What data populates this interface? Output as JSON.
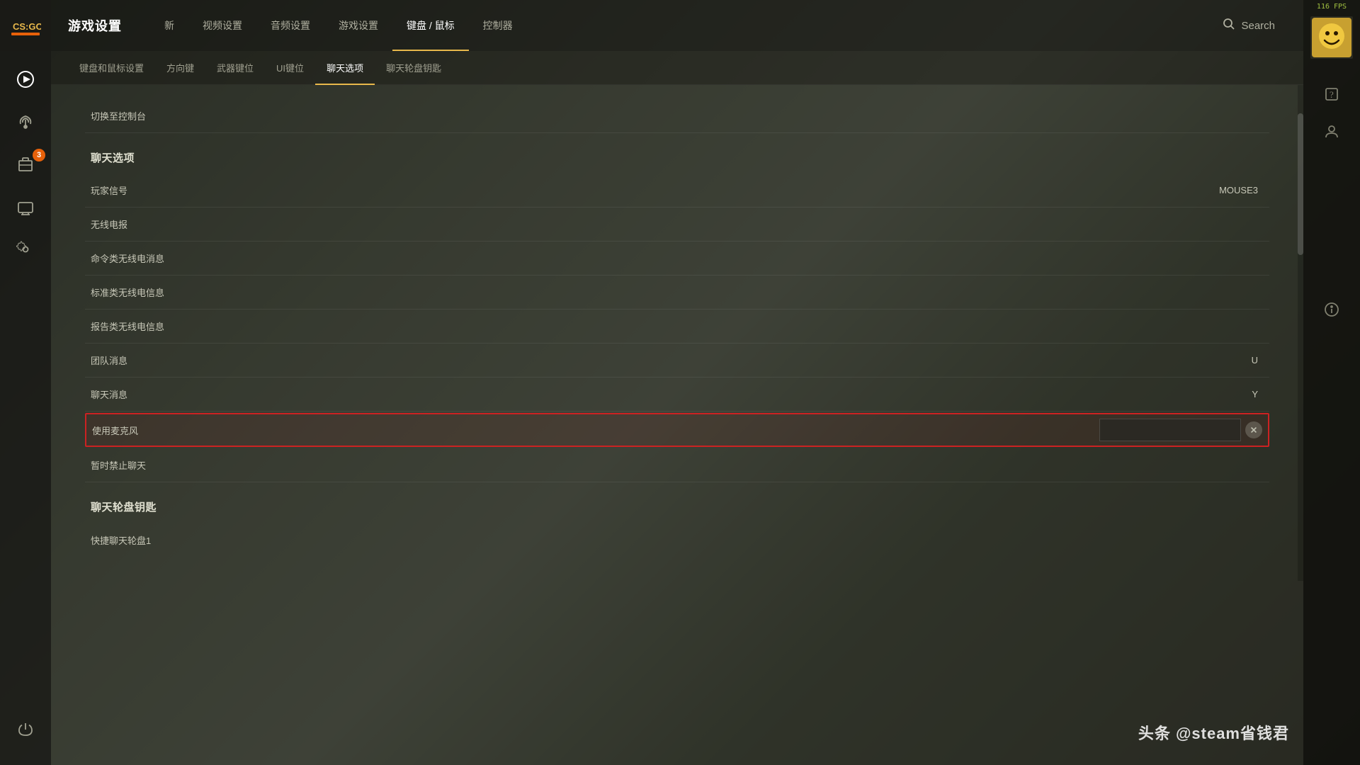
{
  "app": {
    "title": "游戏设置",
    "fps": "116 FPS"
  },
  "top_nav": {
    "items": [
      {
        "id": "new",
        "label": "新",
        "active": false
      },
      {
        "id": "video",
        "label": "视频设置",
        "active": false
      },
      {
        "id": "audio",
        "label": "音频设置",
        "active": false
      },
      {
        "id": "game",
        "label": "游戏设置",
        "active": false
      },
      {
        "id": "keyboard",
        "label": "键盘 / 鼠标",
        "active": true
      },
      {
        "id": "controller",
        "label": "控制器",
        "active": false
      }
    ],
    "search_placeholder": "Search"
  },
  "sub_nav": {
    "items": [
      {
        "id": "kb_settings",
        "label": "键盘和鼠标设置",
        "active": false
      },
      {
        "id": "direction",
        "label": "方向键",
        "active": false
      },
      {
        "id": "weapon_keys",
        "label": "武器键位",
        "active": false
      },
      {
        "id": "ui_keys",
        "label": "UI键位",
        "active": false
      },
      {
        "id": "chat_options",
        "label": "聊天选项",
        "active": true
      },
      {
        "id": "chat_wheel",
        "label": "聊天轮盘钥匙",
        "active": false
      }
    ]
  },
  "chat_options_section": {
    "title": "聊天选项",
    "rows": [
      {
        "id": "player_signal",
        "label": "玩家信号",
        "value": "MOUSE3",
        "highlighted": false
      },
      {
        "id": "radio",
        "label": "无线电报",
        "value": "",
        "highlighted": false
      },
      {
        "id": "cmd_radio",
        "label": "命令类无线电消息",
        "value": "",
        "highlighted": false
      },
      {
        "id": "std_radio",
        "label": "标准类无线电信息",
        "value": "",
        "highlighted": false
      },
      {
        "id": "report_radio",
        "label": "报告类无线电信息",
        "value": "",
        "highlighted": false
      },
      {
        "id": "team_msg",
        "label": "团队消息",
        "value": "U",
        "highlighted": false
      },
      {
        "id": "chat_msg",
        "label": "聊天消息",
        "value": "Y",
        "highlighted": false
      },
      {
        "id": "use_mic",
        "label": "使用麦克风",
        "value": "",
        "highlighted": true
      },
      {
        "id": "mute_chat",
        "label": "暂时禁止聊天",
        "value": "",
        "highlighted": false
      }
    ]
  },
  "chat_wheel_section": {
    "title": "聊天轮盘钥匙",
    "rows": [
      {
        "id": "quick_wheel1",
        "label": "快捷聊天轮盘1",
        "value": ""
      }
    ]
  },
  "cut_row": {
    "label": "切换至控制台",
    "value": ""
  },
  "sidebar": {
    "items": [
      {
        "id": "play",
        "icon": "play"
      },
      {
        "id": "antenna",
        "icon": "antenna"
      },
      {
        "id": "inventory",
        "icon": "folder",
        "badge": "3"
      },
      {
        "id": "tv",
        "icon": "tv"
      },
      {
        "id": "settings",
        "icon": "settings"
      }
    ],
    "bottom": [
      {
        "id": "power",
        "icon": "power"
      }
    ]
  },
  "right_panel": {
    "items": [
      {
        "id": "help",
        "icon": "help"
      },
      {
        "id": "profile",
        "icon": "profile"
      },
      {
        "id": "info",
        "icon": "info"
      }
    ]
  },
  "watermark": "头条 @steam省钱君"
}
